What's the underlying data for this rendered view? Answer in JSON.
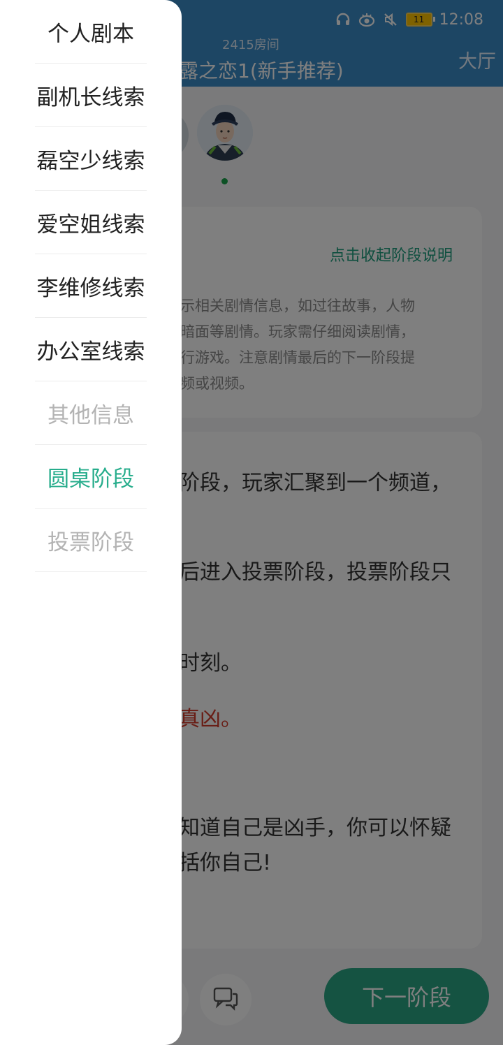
{
  "status_bar": {
    "time": "12:08",
    "battery_level": "11",
    "icons": [
      "headset-icon",
      "eye-icon",
      "mute-icon",
      "battery-icon"
    ]
  },
  "header": {
    "room_number": "2415房间",
    "title": "露之恋1(新手推荐)",
    "lobby_label": "大厅"
  },
  "stage_card": {
    "collapse_label": "点击收起阶段说明",
    "description_lines": [
      "示相关剧情信息，如过往故事，人物",
      "暗面等剧情。玩家需仔细阅读剧情，",
      "行游戏。注意剧情最后的下一阶段提",
      "频或视频。"
    ]
  },
  "main_card": {
    "lines": [
      "阶段，玩家汇聚到一个频道，",
      "后进入投票阶段，投票阶段只",
      "时刻。",
      "真凶。",
      "知道自己是凶手，你可以怀疑",
      "括你自己!"
    ]
  },
  "bottom_bar": {
    "next_stage_label": "下一阶段"
  },
  "drawer": {
    "items": [
      {
        "label": "个人剧本",
        "state": "normal"
      },
      {
        "label": "副机长线索",
        "state": "normal"
      },
      {
        "label": "磊空少线索",
        "state": "normal"
      },
      {
        "label": "爱空姐线索",
        "state": "normal"
      },
      {
        "label": "李维修线索",
        "state": "normal"
      },
      {
        "label": "办公室线索",
        "state": "normal"
      },
      {
        "label": "其他信息",
        "state": "disabled"
      },
      {
        "label": "圆桌阶段",
        "state": "active"
      },
      {
        "label": "投票阶段",
        "state": "disabled"
      }
    ]
  },
  "colors": {
    "header_blue": "#3a8cc9",
    "accent_green": "#2ba685",
    "active_item_green": "#27ad8c",
    "warning_red": "#d23a2a"
  }
}
